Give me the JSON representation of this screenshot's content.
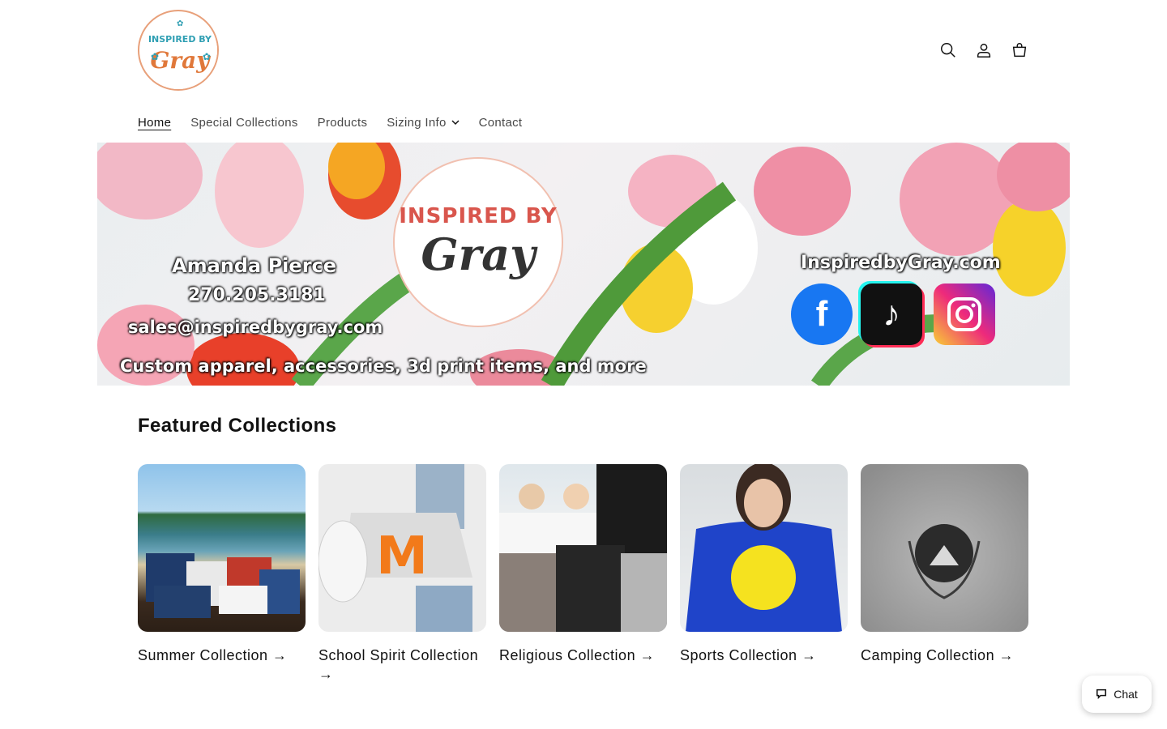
{
  "header": {
    "logo_text": [
      "INSPIRED BY",
      "Gray"
    ],
    "icons": [
      "search-icon",
      "account-icon",
      "cart-icon"
    ]
  },
  "nav": {
    "items": [
      {
        "label": "Home",
        "active": true
      },
      {
        "label": "Special Collections",
        "active": false
      },
      {
        "label": "Products",
        "active": false
      },
      {
        "label": "Sizing Info",
        "active": false,
        "dropdown": true
      },
      {
        "label": "Contact",
        "active": false
      }
    ]
  },
  "banner": {
    "logo_line1": "INSPIRED BY",
    "logo_line2": "Gray",
    "name": "Amanda Pierce",
    "phone": "270.205.3181",
    "email": "sales@inspiredbygray.com",
    "tagline": "Custom apparel, accessories, 3d print items, and more",
    "website": "InspiredbyGray.com",
    "social_icons": [
      "facebook-icon",
      "tiktok-icon",
      "instagram-icon"
    ]
  },
  "featured": {
    "title": "Featured Collections",
    "collections": [
      {
        "label": "Summer Collection →"
      },
      {
        "label": "School Spirit Collection →"
      },
      {
        "label": "Religious Collection →"
      },
      {
        "label": "Sports Collection →"
      },
      {
        "label": "Camping Collection →"
      }
    ]
  },
  "chat": {
    "label": "Chat"
  },
  "colors": {
    "text": "#121212",
    "background": "#ffffff"
  }
}
